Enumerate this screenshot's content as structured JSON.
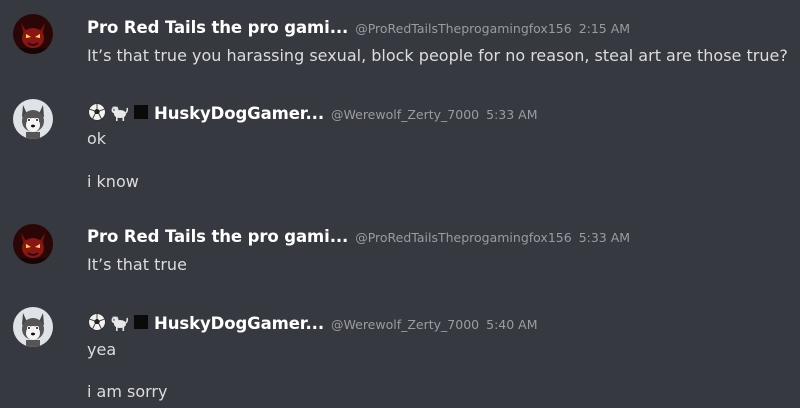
{
  "messages": [
    {
      "username": "Pro Red Tails the pro gami...",
      "handle": "@ProRedTailsTheprogamingfox156",
      "time": "2:15 AM",
      "avatar_icon": "red-fox-avatar",
      "lines": [
        "It’s that true you harassing sexual, block people for no reason, steal art are those true?"
      ]
    },
    {
      "username": "HuskyDogGamer...",
      "handle": "@Werewolf_Zerty_7000",
      "time": "5:33 AM",
      "avatar_icon": "husky-avatar",
      "badge_icons": [
        "soccer-ball-icon",
        "dog-icon",
        "black-square-icon"
      ],
      "lines": [
        "ok",
        "i know"
      ]
    },
    {
      "username": "Pro Red Tails the pro gami...",
      "handle": "@ProRedTailsTheprogamingfox156",
      "time": "5:33 AM",
      "avatar_icon": "red-fox-avatar",
      "lines": [
        "It’s that true"
      ]
    },
    {
      "username": "HuskyDogGamer...",
      "handle": "@Werewolf_Zerty_7000",
      "time": "5:40 AM",
      "avatar_icon": "husky-avatar",
      "badge_icons": [
        "soccer-ball-icon",
        "dog-icon",
        "black-square-icon"
      ],
      "lines": [
        "yea",
        "i am sorry"
      ]
    }
  ],
  "colors": {
    "background": "#36393f",
    "username": "#ffffff",
    "text": "#dcddde",
    "muted": "#9a9ca1"
  }
}
